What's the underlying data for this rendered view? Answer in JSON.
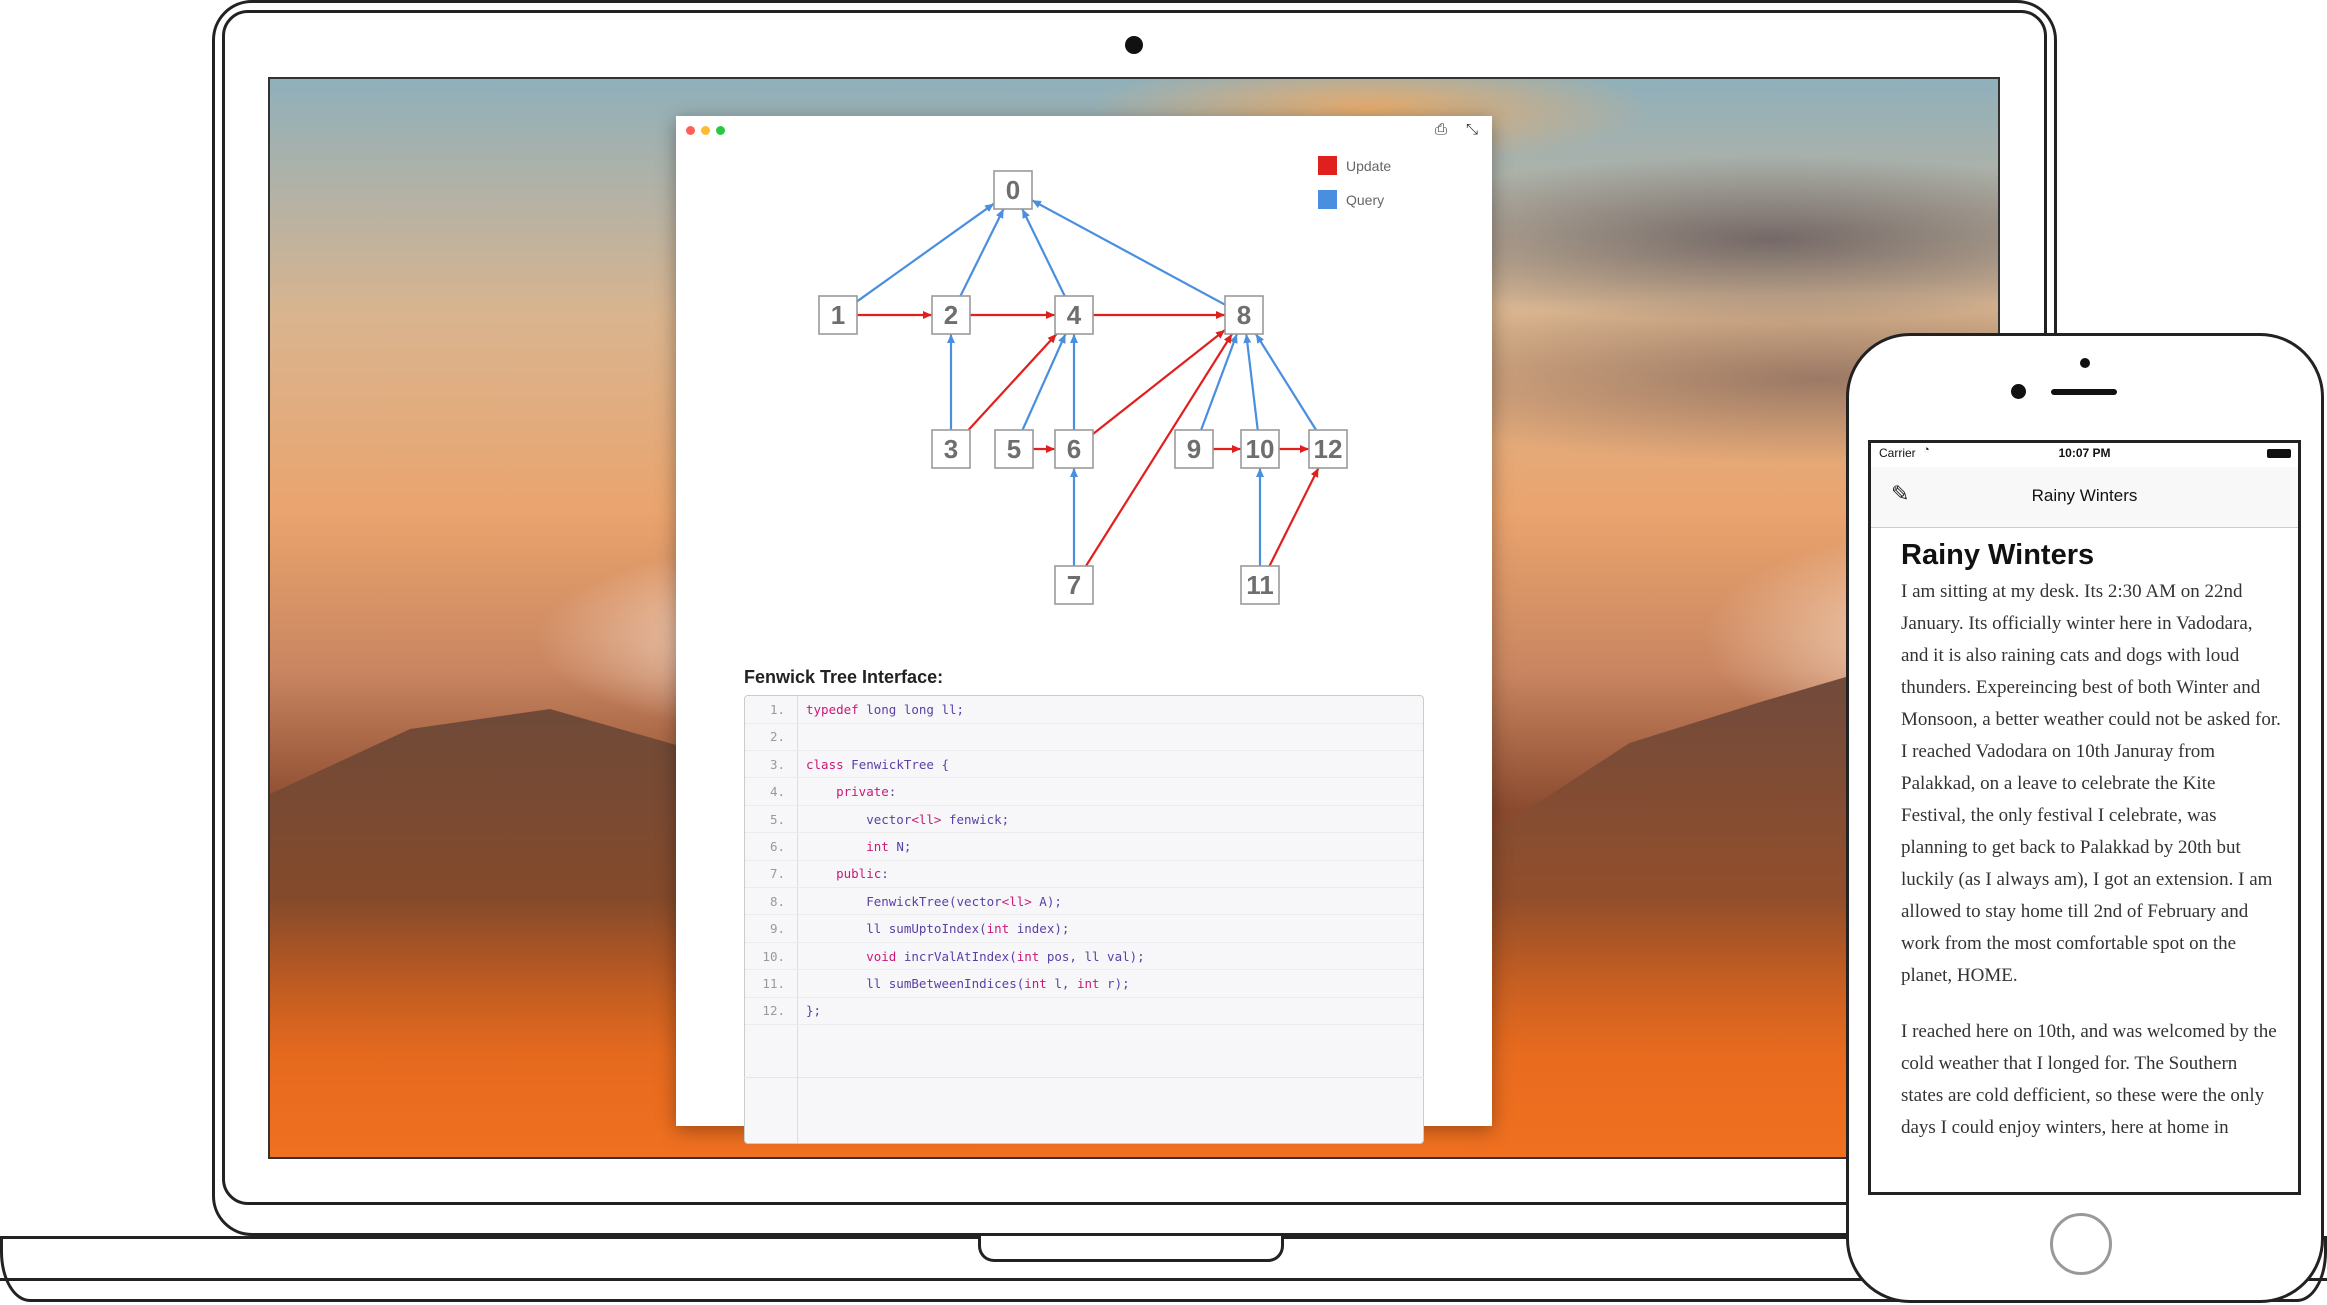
{
  "window": {
    "print_icon": "printer-icon",
    "collapse_icon": "collapse-icon"
  },
  "legend": [
    {
      "label": "Update",
      "color": "#e0201e"
    },
    {
      "label": "Query",
      "color": "#4a8ee0"
    }
  ],
  "graph": {
    "nodes": [
      "0",
      "1",
      "2",
      "3",
      "4",
      "5",
      "6",
      "7",
      "8",
      "9",
      "10",
      "11",
      "12"
    ]
  },
  "code_section": {
    "title": "Fenwick Tree Interface:",
    "lines": [
      {
        "n": "1.",
        "code": "typedef long long ll;"
      },
      {
        "n": "2.",
        "code": ""
      },
      {
        "n": "3.",
        "code": "class FenwickTree {"
      },
      {
        "n": "4.",
        "code": "    private:"
      },
      {
        "n": "5.",
        "code": "        vector<ll> fenwick;"
      },
      {
        "n": "6.",
        "code": "        int N;"
      },
      {
        "n": "7.",
        "code": "    public:"
      },
      {
        "n": "8.",
        "code": "        FenwickTree(vector<ll> A);"
      },
      {
        "n": "9.",
        "code": "        ll sumUptoIndex(int index);"
      },
      {
        "n": "10.",
        "code": "        void incrValAtIndex(int pos, ll val);"
      },
      {
        "n": "11.",
        "code": "        ll sumBetweenIndices(int l, int r);"
      },
      {
        "n": "12.",
        "code": "};"
      }
    ]
  },
  "phone": {
    "status": {
      "carrier": "Carrier",
      "time": "10:07 PM"
    },
    "nav_title": "Rainy Winters",
    "article_title": "Rainy Winters",
    "paragraphs": [
      "I am sitting at my desk. Its 2:30 AM on 22nd January. Its officially winter here in Vadodara, and it is also raining cats and dogs with loud thunders. Expereincing best of both Winter and Monsoon, a better weather could not be asked for. I reached Vadodara on 10th Januray from Palakkad, on a leave to celebrate the Kite Festival, the only festival I celebrate, was planning to get back to Palakkad by 20th but luckily (as I always am), I got an extension. I am allowed to stay home till 2nd of February and work from the most comfortable spot on the planet, HOME.",
      "I reached here on 10th, and was welcomed by the cold weather that I longed for. The Southern states are cold defficient, so these were the only days I could enjoy winters, here at home in"
    ]
  }
}
